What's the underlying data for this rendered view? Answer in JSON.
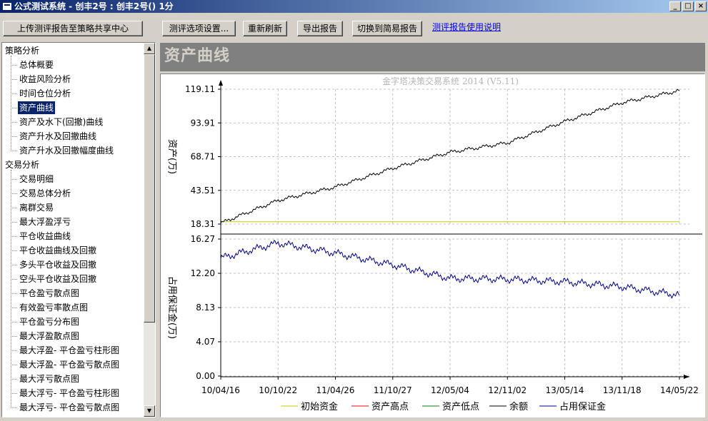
{
  "window": {
    "title": "公式测试系统 - 创丰2号 : 创丰2号() 1分",
    "controls": [
      "_",
      "□",
      "×"
    ]
  },
  "toolbar": {
    "upload": "上传测评报告至策略共享中心",
    "options": "测评选项设置...",
    "refresh": "重新刷新",
    "export": "导出报告",
    "switch": "切换到简易报告",
    "help_link": "测评报告使用说明"
  },
  "tree": {
    "groups": [
      {
        "label": "策略分析",
        "items": [
          "总体概要",
          "收益风险分析",
          "时间仓位分析",
          "资产曲线",
          "资产及水下(回撤)曲线",
          "资产升水及回撤曲线",
          "资产升水及回撤幅度曲线"
        ]
      },
      {
        "label": "交易分析",
        "items": [
          "交易明细",
          "交易总体分析",
          "离群交易",
          "最大浮盈浮亏",
          "平仓收益曲线",
          "平仓收益曲线及回撤",
          "多头平仓收益及回撤",
          "空头平仓收益及回撤",
          "平仓盈亏散点图",
          "有效盈亏率散点图",
          "平仓盈亏分布图",
          "最大浮盈散点图",
          "最大浮盈- 平仓盈亏柱形图",
          "最大浮盈- 平仓盈亏散点图",
          "最大浮亏散点图",
          "最大浮亏- 平仓盈亏柱形图",
          "最大浮亏- 平仓盈亏散点图"
        ]
      }
    ],
    "selected": "资产曲线"
  },
  "section_title": "资产曲线",
  "chart_data": {
    "type": "line",
    "title": "金字塔决策交易系统 2014 (V5.11)",
    "x": [
      "10/04/16",
      "10/10/22",
      "11/04/26",
      "11/10/27",
      "12/05/04",
      "12/11/02",
      "13/05/14",
      "13/11/18",
      "14/05/22"
    ],
    "panels": [
      {
        "ylabel": "资产(万)",
        "yticks": [
          "119.11",
          "93.91",
          "68.71",
          "43.51",
          "18.31"
        ],
        "ylim": [
          18.31,
          119.11
        ],
        "series": [
          {
            "name": "初始资金",
            "color": "#c8c800",
            "values": [
              20,
              20,
              20,
              20,
              20,
              20,
              20,
              20,
              20
            ]
          },
          {
            "name": "余额",
            "color": "#000000",
            "values": [
              19,
              36,
              46,
              60,
              72,
              79,
              95,
              109,
              118
            ]
          }
        ]
      },
      {
        "ylabel": "占用保证金(万)",
        "yticks": [
          "16.27",
          "12.20",
          "8.13",
          "4.07",
          "0.00"
        ],
        "ylim": [
          0,
          16.27
        ],
        "series": [
          {
            "name": "占用保证金",
            "color": "#00008b",
            "values": [
              14,
              15.8,
              14.6,
              13.2,
              11.6,
              11.5,
              11.2,
              10.6,
              9.6
            ]
          }
        ]
      }
    ],
    "legend": [
      {
        "name": "初始资金",
        "color": "#c8c800"
      },
      {
        "name": "资产高点",
        "color": "#ff0000"
      },
      {
        "name": "资产低点",
        "color": "#008000"
      },
      {
        "name": "余额",
        "color": "#000000"
      },
      {
        "name": "占用保证金",
        "color": "#00008b"
      }
    ]
  }
}
